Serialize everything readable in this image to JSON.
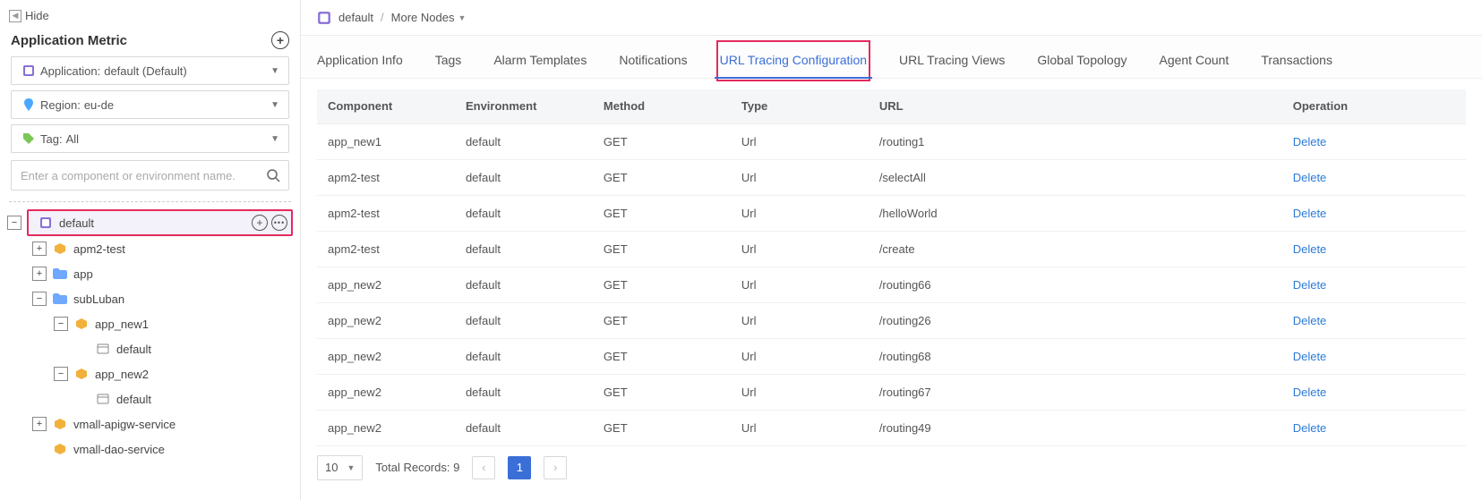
{
  "sidebar": {
    "hide_label": "Hide",
    "header": "Application Metric",
    "app_sel": {
      "label": "Application:",
      "value": "default (Default)"
    },
    "region_sel": {
      "label": "Region:",
      "value": "eu-de"
    },
    "tag_sel": {
      "label": "Tag:",
      "value": "All"
    },
    "search_placeholder": "Enter a component or environment name."
  },
  "tree": {
    "root_label": "default",
    "items": [
      {
        "label": "apm2-test"
      },
      {
        "label": "app"
      },
      {
        "label": "subLuban",
        "expanded": true,
        "children": [
          {
            "label": "app_new1",
            "env": "default"
          },
          {
            "label": "app_new2",
            "env": "default"
          }
        ]
      },
      {
        "label": "vmall-apigw-service"
      },
      {
        "label": "vmall-dao-service"
      }
    ]
  },
  "breadcrumb": {
    "app": "default",
    "more": "More Nodes"
  },
  "tabs": [
    "Application Info",
    "Tags",
    "Alarm Templates",
    "Notifications",
    "URL Tracing Configuration",
    "URL Tracing Views",
    "Global Topology",
    "Agent Count",
    "Transactions"
  ],
  "active_tab_index": 4,
  "table": {
    "headers": [
      "Component",
      "Environment",
      "Method",
      "Type",
      "URL",
      "Operation"
    ],
    "op_label": "Delete",
    "rows": [
      {
        "component": "app_new1",
        "env": "default",
        "method": "GET",
        "type": "Url",
        "url": "/routing1"
      },
      {
        "component": "apm2-test",
        "env": "default",
        "method": "GET",
        "type": "Url",
        "url": "/selectAll"
      },
      {
        "component": "apm2-test",
        "env": "default",
        "method": "GET",
        "type": "Url",
        "url": "/helloWorld"
      },
      {
        "component": "apm2-test",
        "env": "default",
        "method": "GET",
        "type": "Url",
        "url": "/create"
      },
      {
        "component": "app_new2",
        "env": "default",
        "method": "GET",
        "type": "Url",
        "url": "/routing66"
      },
      {
        "component": "app_new2",
        "env": "default",
        "method": "GET",
        "type": "Url",
        "url": "/routing26"
      },
      {
        "component": "app_new2",
        "env": "default",
        "method": "GET",
        "type": "Url",
        "url": "/routing68"
      },
      {
        "component": "app_new2",
        "env": "default",
        "method": "GET",
        "type": "Url",
        "url": "/routing67"
      },
      {
        "component": "app_new2",
        "env": "default",
        "method": "GET",
        "type": "Url",
        "url": "/routing49"
      }
    ]
  },
  "pager": {
    "page_size": "10",
    "total_label": "Total Records: 9",
    "current": "1"
  }
}
